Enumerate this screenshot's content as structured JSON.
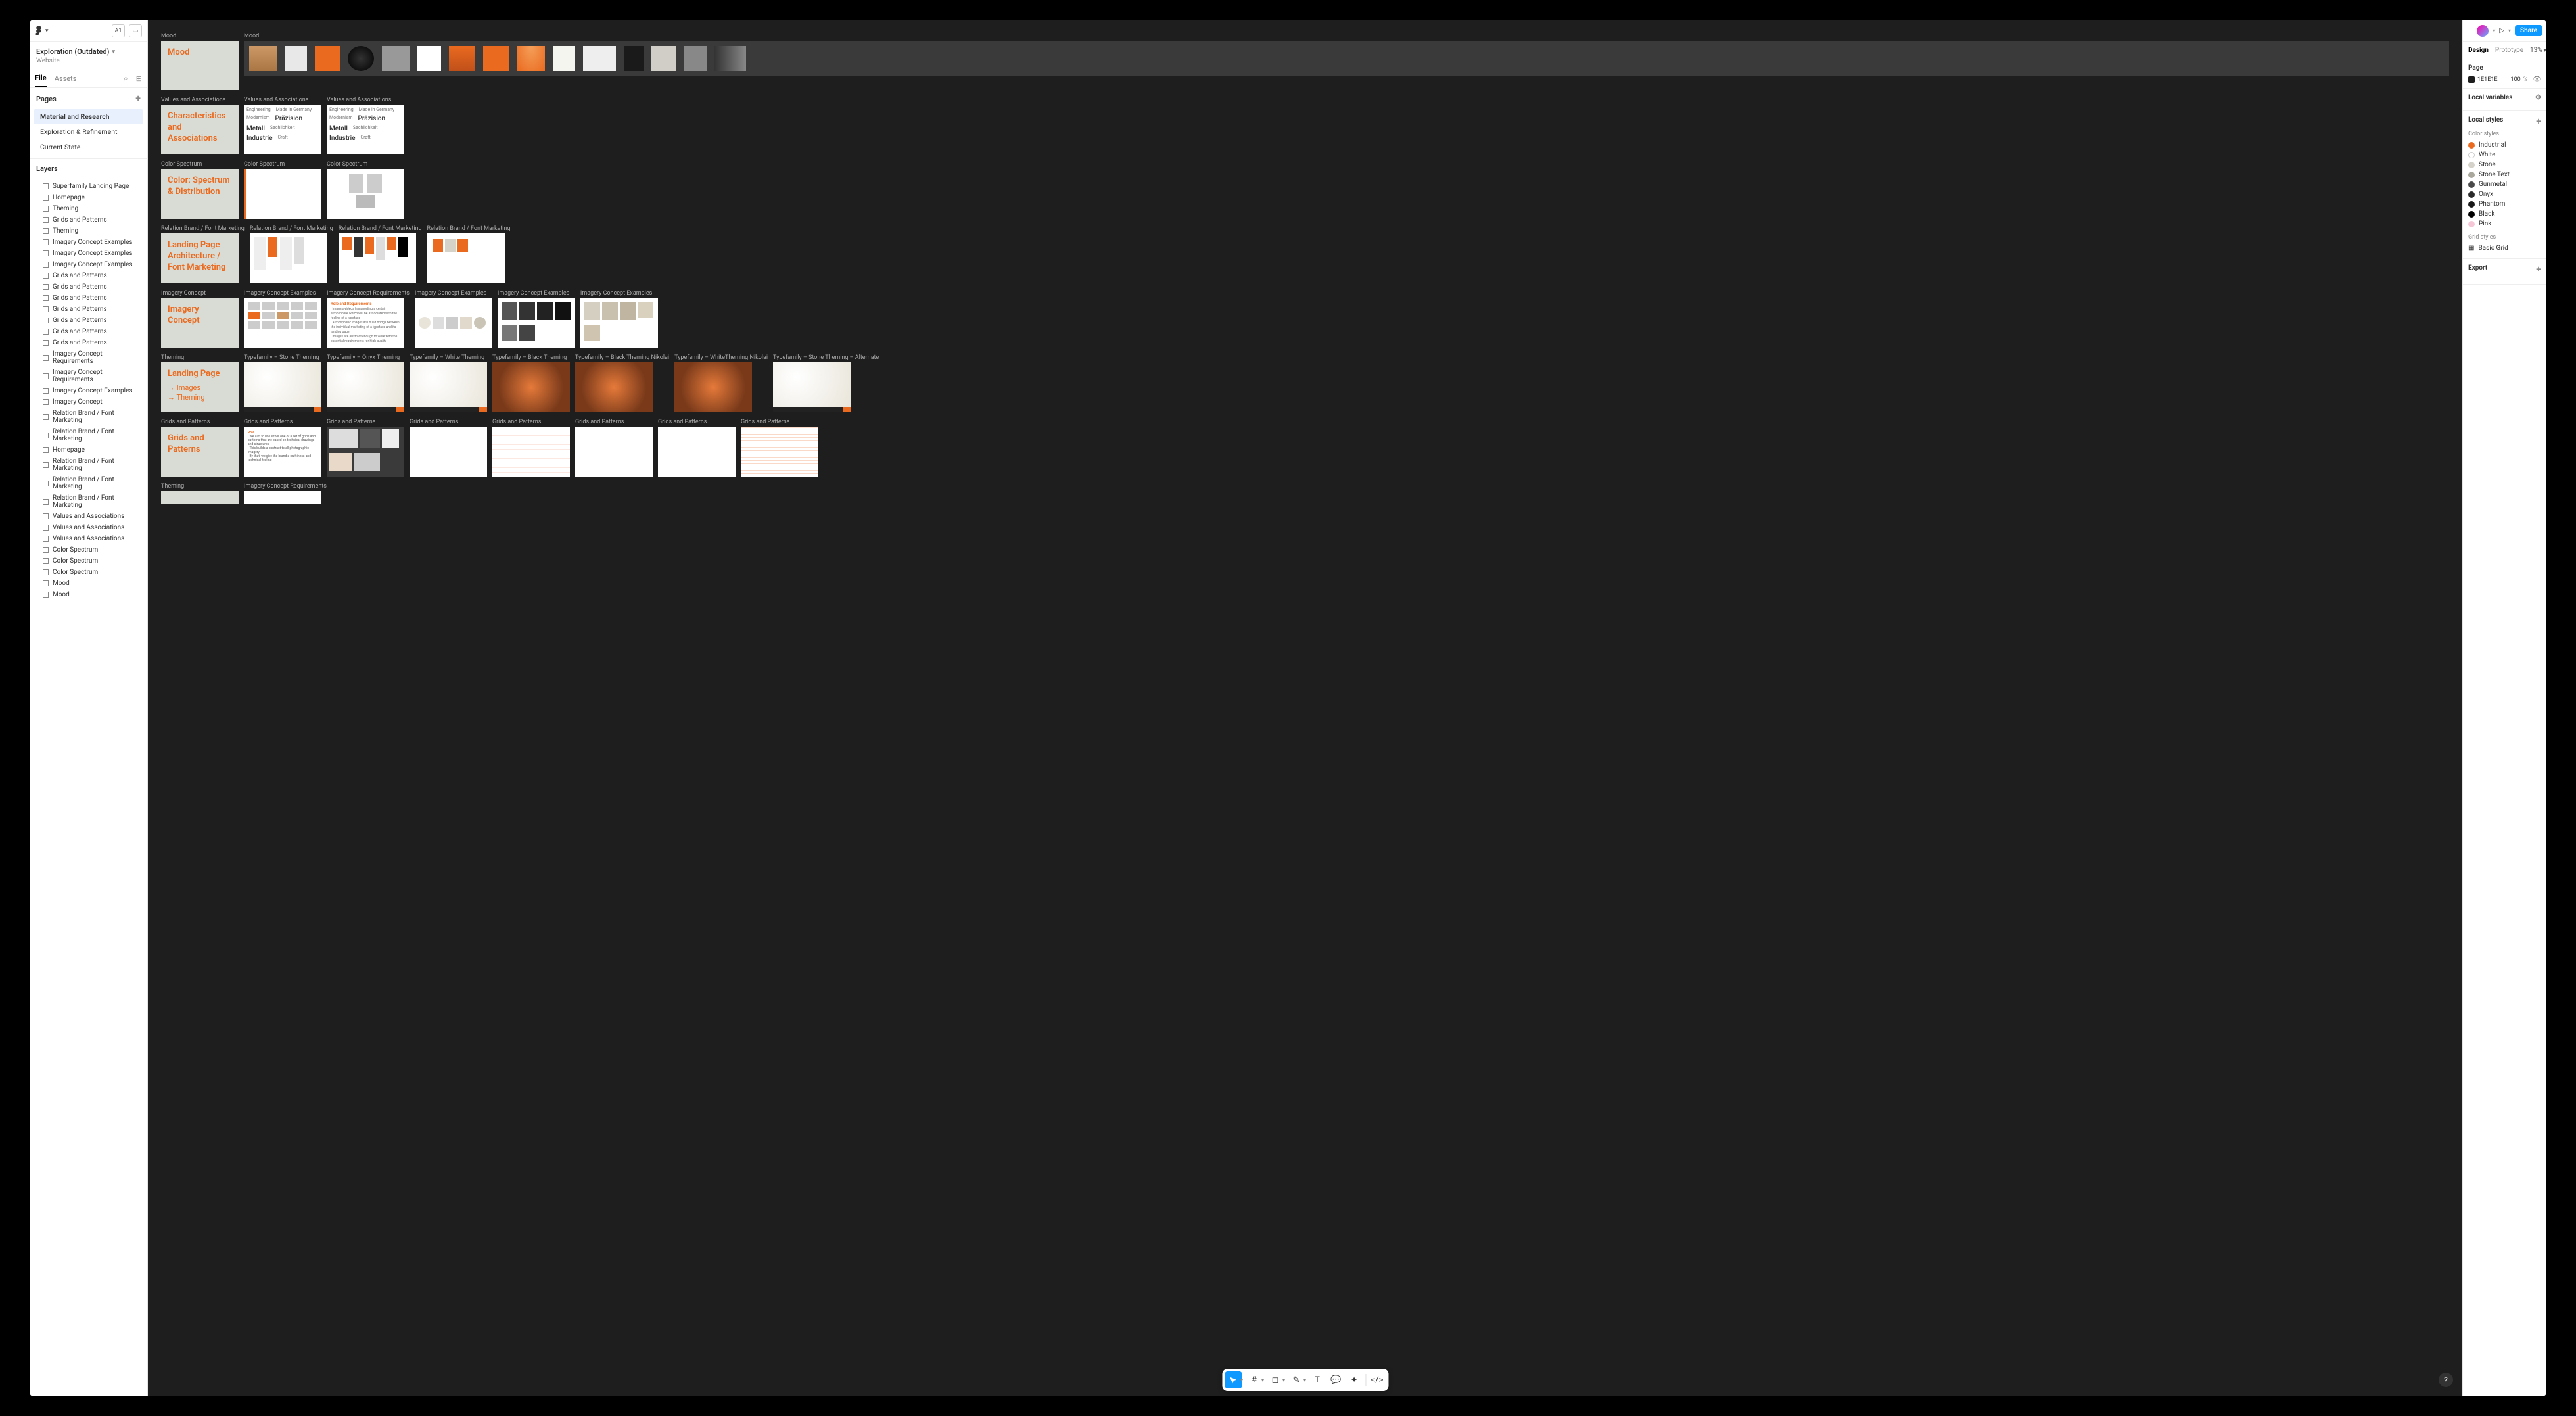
{
  "file": {
    "name": "Exploration (Outdated)",
    "team": "Website"
  },
  "leftTabs": {
    "file": "File",
    "assets": "Assets"
  },
  "pagesHeader": "Pages",
  "pages": [
    "Material and Research",
    "Exploration & Refinement",
    "Current State"
  ],
  "selectedPageIndex": 0,
  "layersHeader": "Layers",
  "layers": [
    "Superfamily Landing Page",
    "Homepage",
    "Theming",
    "Grids and Patterns",
    "Theming",
    "Imagery Concept Examples",
    "Imagery Concept Examples",
    "Imagery Concept Examples",
    "Grids and Patterns",
    "Grids and Patterns",
    "Grids and Patterns",
    "Grids and Patterns",
    "Grids and Patterns",
    "Grids and Patterns",
    "Grids and Patterns",
    "Imagery Concept Requirements",
    "Imagery Concept Requirements",
    "Imagery Concept Examples",
    "Imagery Concept",
    "Relation Brand / Font Marketing",
    "Relation Brand / Font Marketing",
    "Homepage",
    "Relation Brand / Font Marketing",
    "Relation Brand / Font Marketing",
    "Relation Brand / Font Marketing",
    "Values and Associations",
    "Values and Associations",
    "Values and Associations",
    "Color Spectrum",
    "Color Spectrum",
    "Color Spectrum",
    "Mood",
    "Mood"
  ],
  "right": {
    "tabs": {
      "design": "Design",
      "prototype": "Prototype"
    },
    "zoom": "13%",
    "pageHeader": "Page",
    "fill": {
      "hex": "1E1E1E",
      "opacity": "100",
      "unit": "%"
    },
    "localVars": "Local variables",
    "localStyles": "Local styles",
    "colorStylesHeader": "Color styles",
    "colorStyles": [
      {
        "name": "Industrial",
        "c": "#ea6a1f"
      },
      {
        "name": "White",
        "c": "#ffffff",
        "border": true
      },
      {
        "name": "Stone",
        "c": "#d4d2c9"
      },
      {
        "name": "Stone Text",
        "c": "#aaa79c"
      },
      {
        "name": "Gunmetal",
        "c": "#4a4a4a"
      },
      {
        "name": "Onyx",
        "c": "#2b2b2b"
      },
      {
        "name": "Phantom",
        "c": "#1a1a1a"
      },
      {
        "name": "Black",
        "c": "#000000"
      },
      {
        "name": "Pink",
        "c": "#f5c6d6"
      }
    ],
    "gridStylesHeader": "Grid styles",
    "gridStyles": [
      "Basic Grid"
    ],
    "exportHeader": "Export",
    "share": "Share"
  },
  "canvas": {
    "mood": {
      "title": "Mood",
      "slide": "Mood"
    },
    "values": {
      "label": "Values and Associations",
      "slide": "Characteristics and Associations",
      "words": [
        "Engineering",
        "Made in Germany",
        "Modernism",
        "Präzision",
        "Metall",
        "Sachlichkeit",
        "Industrie",
        "Craft"
      ]
    },
    "color": {
      "label": "Color Spectrum",
      "slide": "Color: Spectrum & Distribution"
    },
    "relation": {
      "label": "Relation Brand / Font Marketing",
      "slide": "Landing Page Architecture / Font Marketing"
    },
    "imagery": {
      "label": "Imagery Concept",
      "slide": "Imagery Concept",
      "exLabel": "Imagery Concept Examples",
      "reqLabel": "Imagery Concept Requirements"
    },
    "theming": {
      "label": "Theming",
      "slide": "Landing Page",
      "sub1": "→ Images",
      "sub2": "→ Theming",
      "tf": [
        "Typefamily – Stone Theming",
        "Typefamily – Onyx Theming",
        "Typefamily – White Theming",
        "Typefamily – Black Theming",
        "Typefamily – Black Theming Nikolai",
        "Typefamily – WhiteTheming Nikolai",
        "Typefamily – Stone Theming – Alternate"
      ]
    },
    "grids": {
      "label": "Grids and Patterns",
      "slide": "Grids and Patterns"
    }
  }
}
